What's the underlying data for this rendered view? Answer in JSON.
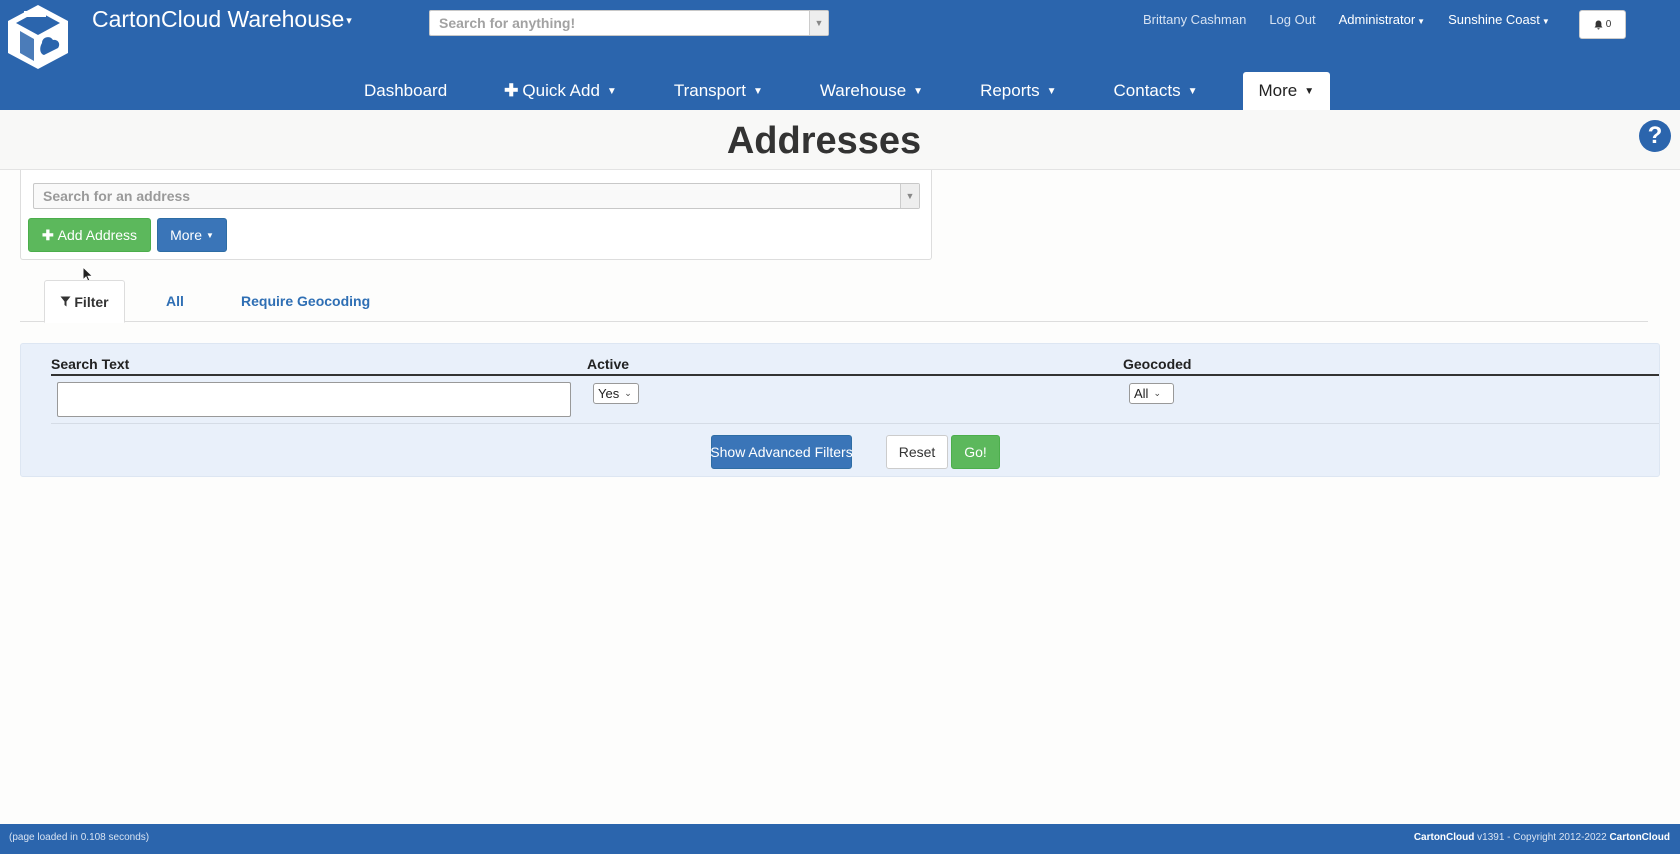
{
  "header": {
    "brand": "CartonCloud Warehouse",
    "search_placeholder": "Search for anything!",
    "user_name": "Brittany Cashman",
    "logout": "Log Out",
    "role": "Administrator",
    "location": "Sunshine Coast",
    "notification_count": "0"
  },
  "nav": {
    "items": [
      {
        "label": "Dashboard"
      },
      {
        "label": "Quick Add"
      },
      {
        "label": "Transport"
      },
      {
        "label": "Warehouse"
      },
      {
        "label": "Reports"
      },
      {
        "label": "Contacts"
      },
      {
        "label": "More"
      }
    ]
  },
  "page": {
    "title": "Addresses"
  },
  "address_panel": {
    "search_placeholder": "Search for an address",
    "add_button": "Add Address",
    "more_button": "More"
  },
  "tabs": [
    {
      "label": "Filter"
    },
    {
      "label": "All"
    },
    {
      "label": "Require Geocoding"
    }
  ],
  "filter": {
    "col_search": "Search Text",
    "col_active": "Active",
    "col_geocoded": "Geocoded",
    "search_value": "",
    "active_value": "Yes",
    "geocoded_value": "All",
    "advanced_button": "Show Advanced Filters",
    "reset_button": "Reset",
    "go_button": "Go!"
  },
  "footer": {
    "load_text": "(page loaded in 0.108 seconds)",
    "brand": "CartonCloud",
    "version_text": " v1391 - Copyright 2012-2022 ",
    "brand2": "CartonCloud"
  },
  "colors": {
    "header_blue": "#2b65ad",
    "success_green": "#5cb85c",
    "primary_blue": "#3a75b8",
    "filter_bg": "#e9f0fa"
  }
}
